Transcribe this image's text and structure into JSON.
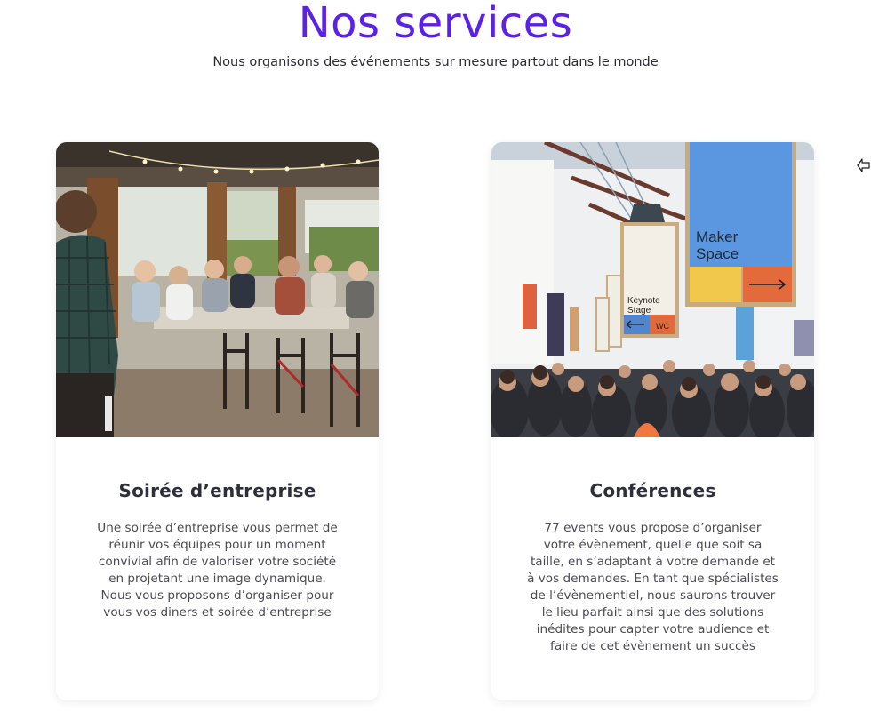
{
  "header": {
    "title": "Nos services",
    "subtitle": "Nous organisons des événements sur mesure partout dans le monde"
  },
  "cards": [
    {
      "title": "Soirée d’entreprise",
      "text": "Une soirée d’entreprise vous permet de réunir vos équipes pour un moment convivial afin de valoriser votre société en projetant une image dynamique. Nous vous proposons d’organiser pour vous vos diners et soirée d’entreprise"
    },
    {
      "title": "Conférences",
      "text": "77 events vous propose d’organiser votre évènement, quelle que soit sa taille, en s’adaptant à votre demande et à vos demandes. En tant que spécialistes de l’évènementiel, nous saurons trouver le lieu parfait ainsi que des solutions inédites pour capter votre audience et faire de cet évènement un succès",
      "image_signs": {
        "maker_line1": "Maker",
        "maker_line2": "Space",
        "keynote_line1": "Keynote",
        "keynote_line2": "Stage",
        "wc": "WC"
      }
    }
  ],
  "colors": {
    "accent": "#5b21e8",
    "text": "#2e2f3a"
  },
  "icons": {
    "cursor": "pointer-arrow-icon"
  }
}
